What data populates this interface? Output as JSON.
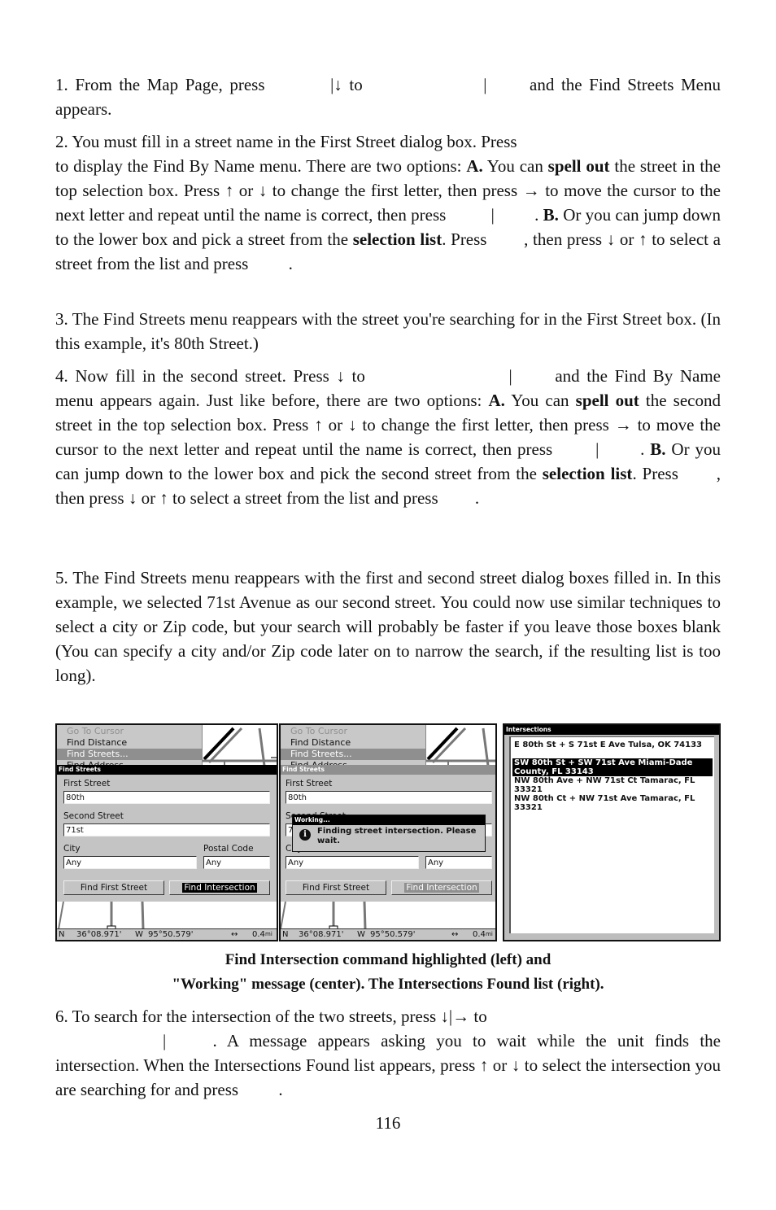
{
  "steps": [
    {
      "id": 1,
      "parts": [
        "1. From the Map Page, press ",
        "|↓ to ",
        "| ",
        "and the Find Streets Menu appears."
      ]
    },
    {
      "id": 2,
      "parts": [
        "2. You must fill in a street name in the First Street dialog box. Press",
        "to display the Find By Name menu. There are two options: ",
        "A.",
        " You can ",
        "spell out",
        " the street in the top selection box. Press ↑ or ↓ to change the first letter, then press → to move the cursor to the next letter and repeat until the name is correct, then press ",
        "| ",
        ". ",
        "B.",
        " Or you can jump down to the lower box and pick a street from the ",
        "selection list",
        ". Press ",
        ", then press ↓ or ↑ to select a street from the list and press ",
        "."
      ]
    },
    {
      "id": 3,
      "text": "3. The Find Streets menu reappears with the street you're searching for in the First Street box. (In this example, it's 80th Street.)"
    },
    {
      "id": 4,
      "parts": [
        "4. Now fill in the second street. Press ↓ to ",
        "| ",
        "and the Find By Name menu appears again. Just like before, there are two op­tions: ",
        "A.",
        " You can ",
        "spell out",
        " the second street in the top selection box. Press ↑ or ↓ to change the first letter, then press → to move the cursor to the next letter and repeat until the name is correct, then press ",
        "| ",
        ". ",
        "B.",
        " Or you can jump down to the lower box and pick the sec­ond street from the ",
        "selection list",
        ". Press ",
        ", then press ↓ or ↑ to se­lect a street from the list and press ",
        "."
      ]
    },
    {
      "id": 5,
      "text": "5. The Find Streets menu reappears with the first and second street dialog boxes filled in. In this example, we selected 71st Avenue as our second street. You could now use similar techniques to select a city or Zip code, but your search will probably be faster if you leave those boxes blank (You can specify a city and/or Zip code later on to narrow the search, if the resulting list is too long)."
    },
    {
      "id": 6,
      "parts": [
        "6. To search for the intersection of the two streets, press ↓|→ to ",
        "| ",
        ". A message appears asking you to wait while the unit finds the intersection. When the Intersections Found list appears, press ↑ or ↓ to select the intersection you are searching for and press ",
        "."
      ]
    }
  ],
  "screens": {
    "menu_items": [
      "Go To Cursor",
      "Find Distance",
      "Find Streets...",
      "Find Address"
    ],
    "dialog_title": "Find Streets",
    "first_street_label": "First Street",
    "first_street_value": "80th",
    "second_street_label": "Second Street",
    "second_street_value": "71st",
    "city_label": "City",
    "city_value": "Any",
    "postal_label": "Postal Code",
    "postal_value": "Any",
    "btn_find_first": "Find First Street",
    "btn_find_intersection": "Find Intersection",
    "status_lat_hemi": "N",
    "status_lat": "36°08.971'",
    "status_lon_hemi": "W",
    "status_lon": "95°50.579'",
    "status_scale_icon": "↔",
    "status_scale": "0.4",
    "status_scale_unit": "mi",
    "working_title": "Working...",
    "working_message": "Finding street intersection.  Please wait.",
    "working_icon": "i",
    "intersections_title": "Intersections",
    "intersections": [
      {
        "text": "E 80th St + S 71st E Ave Tulsa, OK  74133",
        "selected": false
      },
      {
        "text": "SW 80th St + SW 71st Ave Miami-Dade County, FL  33143",
        "selected": true
      },
      {
        "text": "NW 80th Ave + NW 71st Ct Tamarac, FL 33321",
        "selected": false
      },
      {
        "text": "NW 80th Ct + NW 71st Ave Tamarac, FL 33321",
        "selected": false
      }
    ]
  },
  "caption": {
    "line1": "Find Intersection command highlighted (left) and",
    "line2": "\"Working\" message (center). The Intersections Found list (right)."
  },
  "page_number": "116"
}
